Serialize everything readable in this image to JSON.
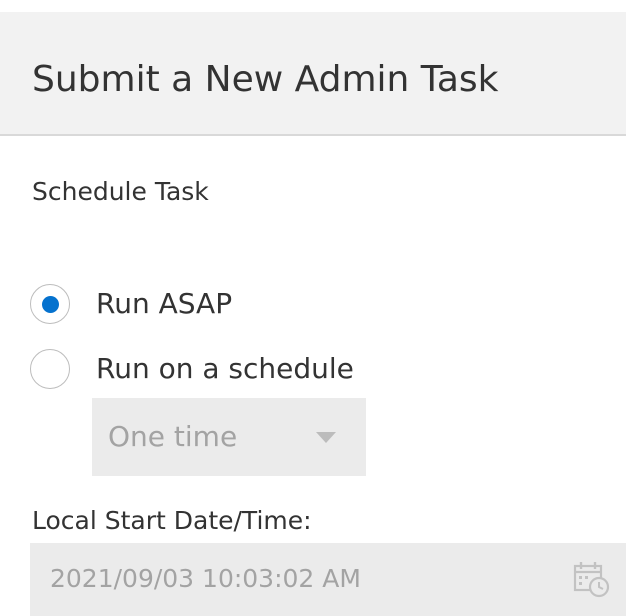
{
  "header": {
    "title": "Submit a New Admin Task"
  },
  "schedule": {
    "section_label": "Schedule Task",
    "options": [
      {
        "label": "Run ASAP",
        "selected": true
      },
      {
        "label": "Run on a schedule",
        "selected": false
      }
    ],
    "frequency": {
      "selected": "One time",
      "disabled": true
    }
  },
  "start": {
    "label": "Local Start Date/Time:",
    "value": "2021/09/03 10:03:02 AM",
    "disabled": true,
    "icon": "calendar-clock-icon"
  },
  "colors": {
    "accent": "#0572ce",
    "header_bg": "#f2f2f2",
    "disabled_bg": "#ebebeb",
    "disabled_text": "#a3a3a3"
  }
}
